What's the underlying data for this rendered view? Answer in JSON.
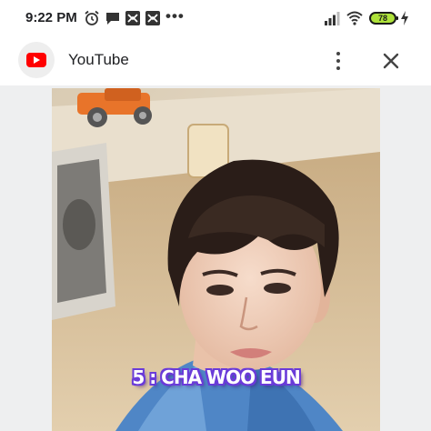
{
  "status_bar": {
    "time": "9:22 PM",
    "battery": "78",
    "icons": [
      "alarm-icon",
      "message-icon",
      "notification-app-icon",
      "notification-app-icon",
      "more-notifications-icon",
      "signal-icon",
      "wifi-icon",
      "battery-icon",
      "charging-icon"
    ]
  },
  "header": {
    "app_name": "YouTube",
    "icons": [
      "youtube-logo-icon",
      "more-vert-icon",
      "close-icon"
    ]
  },
  "video": {
    "caption": "5 : CHA WOO EUN",
    "caption_color": "#6a3bd9"
  }
}
